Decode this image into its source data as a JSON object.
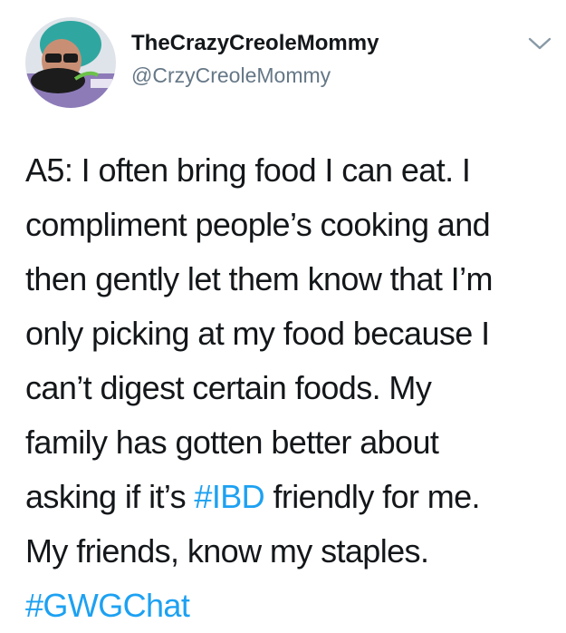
{
  "author": {
    "display_name": "TheCrazyCreoleMommy",
    "handle": "@CrzyCreoleMommy",
    "avatar_icon": "profile-photo-avatar"
  },
  "menu": {
    "icon": "chevron-down-icon"
  },
  "tweet": {
    "lines": [
      {
        "text": "A5: I often bring food I can eat. I"
      },
      {
        "text": "compliment people’s cooking and"
      },
      {
        "text": "then gently let them know that I’m"
      },
      {
        "text": "only picking at my food because I"
      },
      {
        "text": "can’t digest certain foods. My"
      },
      {
        "text": "family has gotten better about"
      },
      {
        "before": "asking if it’s ",
        "hashtag": "#IBD",
        "after": " friendly for me."
      },
      {
        "text": "My friends, know my staples."
      },
      {
        "hashtag": "#GWGChat"
      }
    ]
  },
  "colors": {
    "text": "#14171a",
    "secondary_text": "#657786",
    "link": "#1da1f2",
    "chevron": "#8899a6"
  }
}
